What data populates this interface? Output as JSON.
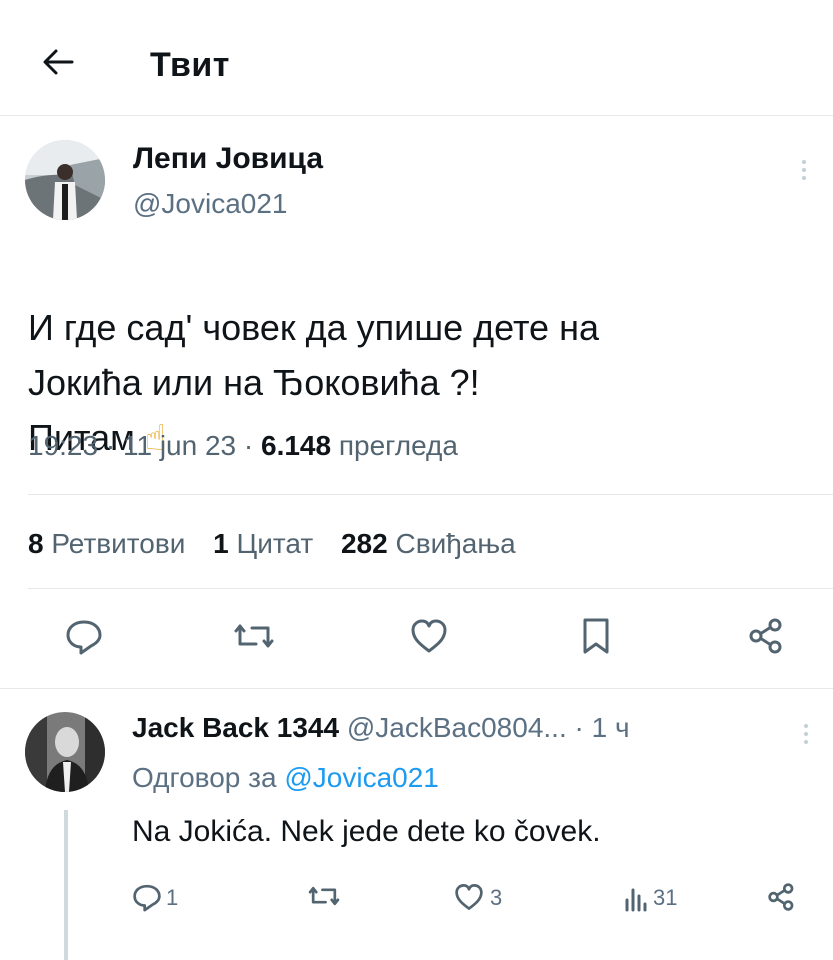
{
  "header": {
    "title": "Твит"
  },
  "tweet": {
    "author_name": "Лепи Јовица",
    "author_handle": "@Jovica021",
    "text": "И где сад' човек да упише дете на\nЈокића или на Ђоковића ?!\nПитам",
    "emoji": "☝",
    "time": "19:23",
    "date": "11 jun 23",
    "views_count": "6.148",
    "views_label": "прегледа",
    "retweets_count": "8",
    "retweets_label": "Ретвитови",
    "quotes_count": "1",
    "quotes_label": "Цитат",
    "likes_count": "282",
    "likes_label": "Свиђања"
  },
  "reply": {
    "author_name": "Jack Back 1344",
    "author_handle": "@JackBac0804...",
    "time": "· 1 ч",
    "replying_prefix": "Одговор за",
    "replying_to": "@Jovica021",
    "text": "Na Jokića. Nek jede dete ko čovek.",
    "reply_count": "1",
    "like_count": "3",
    "views_count": "31"
  },
  "colors": {
    "accent": "#1d9bf0",
    "secondary_text": "#536471",
    "divider": "#e6e9ec"
  },
  "icons": [
    "back-arrow-icon",
    "more-icon",
    "reply-icon",
    "retweet-icon",
    "like-icon",
    "bookmark-icon",
    "share-icon",
    "views-icon"
  ]
}
